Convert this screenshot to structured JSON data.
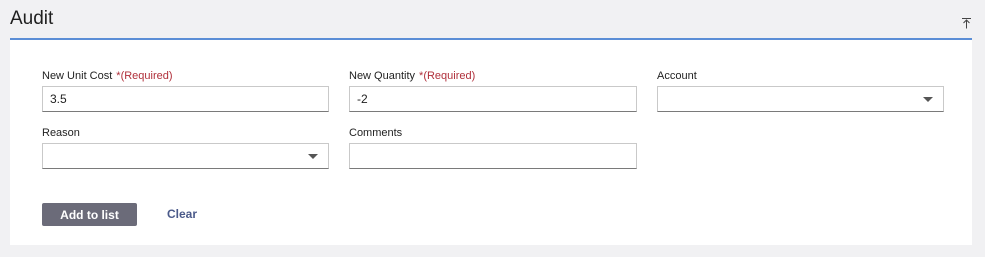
{
  "section": {
    "title": "Audit",
    "collapse_icon": "collapse-up-icon"
  },
  "fields": {
    "new_unit_cost": {
      "label": "New Unit Cost",
      "required_star": "*",
      "required_text": "(Required)",
      "value": "3.5"
    },
    "new_quantity": {
      "label": "New Quantity",
      "required_star": "*",
      "required_text": "(Required)",
      "value": "-2"
    },
    "account": {
      "label": "Account",
      "selected": ""
    },
    "reason": {
      "label": "Reason",
      "selected": ""
    },
    "comments": {
      "label": "Comments",
      "value": ""
    }
  },
  "actions": {
    "add_label": "Add to list",
    "clear_label": "Clear"
  },
  "colors": {
    "accent_border": "#5b8ed6",
    "required": "#b02f3a",
    "primary_button": "#6b6b79",
    "link": "#4b5a8a"
  }
}
